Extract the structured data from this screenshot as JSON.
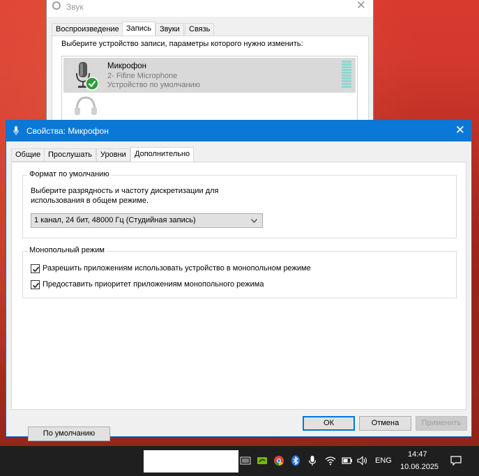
{
  "sound_window": {
    "title": "Звук",
    "close_glyph": "✕",
    "tabs": [
      {
        "label": "Воспроизведение",
        "active": false
      },
      {
        "label": "Запись",
        "active": true
      },
      {
        "label": "Звуки",
        "active": false
      },
      {
        "label": "Связь",
        "active": false
      }
    ],
    "prompt": "Выберите устройство записи, параметры которого нужно изменить:",
    "devices": [
      {
        "name": "Микрофон",
        "description": "2- Fifine Microphone",
        "status": "Устройство по умолчанию",
        "icon": "microphone-icon",
        "default_badge": "green-check-icon"
      },
      {
        "icon": "headset-icon"
      }
    ]
  },
  "dialog": {
    "title": "Свойства: Микрофон",
    "close_glyph": "✕",
    "tabs": [
      {
        "label": "Общие",
        "active": false
      },
      {
        "label": "Прослушать",
        "active": false
      },
      {
        "label": "Уровни",
        "active": false
      },
      {
        "label": "Дополнительно",
        "active": true
      }
    ],
    "format_group": {
      "title": "Формат по умолчанию",
      "description_line1": "Выберите разрядность и частоту дискретизации для",
      "description_line2": "использования в общем режиме.",
      "selected_format": "1 канал, 24 бит, 48000 Гц (Студийная запись)"
    },
    "exclusive_group": {
      "title": "Монопольный режим",
      "options": [
        {
          "label": "Разрешить приложениям использовать устройство в монопольном режиме",
          "checked": true
        },
        {
          "label": "Предоставить приоритет приложениям монопольного режима",
          "checked": true
        }
      ]
    },
    "buttons": {
      "defaults": "По умолчанию",
      "ok": "ОК",
      "cancel": "Отмена",
      "apply": "Применить"
    }
  },
  "taskbar": {
    "tray_icons": [
      "keyboard-icon",
      "nvidia-icon",
      "chrome-icon",
      "bluetooth-icon",
      "microphone-icon",
      "wifi-icon",
      "battery-icon",
      "volume-icon"
    ],
    "language": "ENG",
    "time": "14:47",
    "date": "10.06.2025",
    "notification_icon": "action-center-icon"
  },
  "colors": {
    "accent": "#0a78d7",
    "wallpaper": "#c23326",
    "taskbar": "#1f1f1f",
    "meter": "#8fd6d0",
    "check_badge": "#2e9e3a"
  }
}
